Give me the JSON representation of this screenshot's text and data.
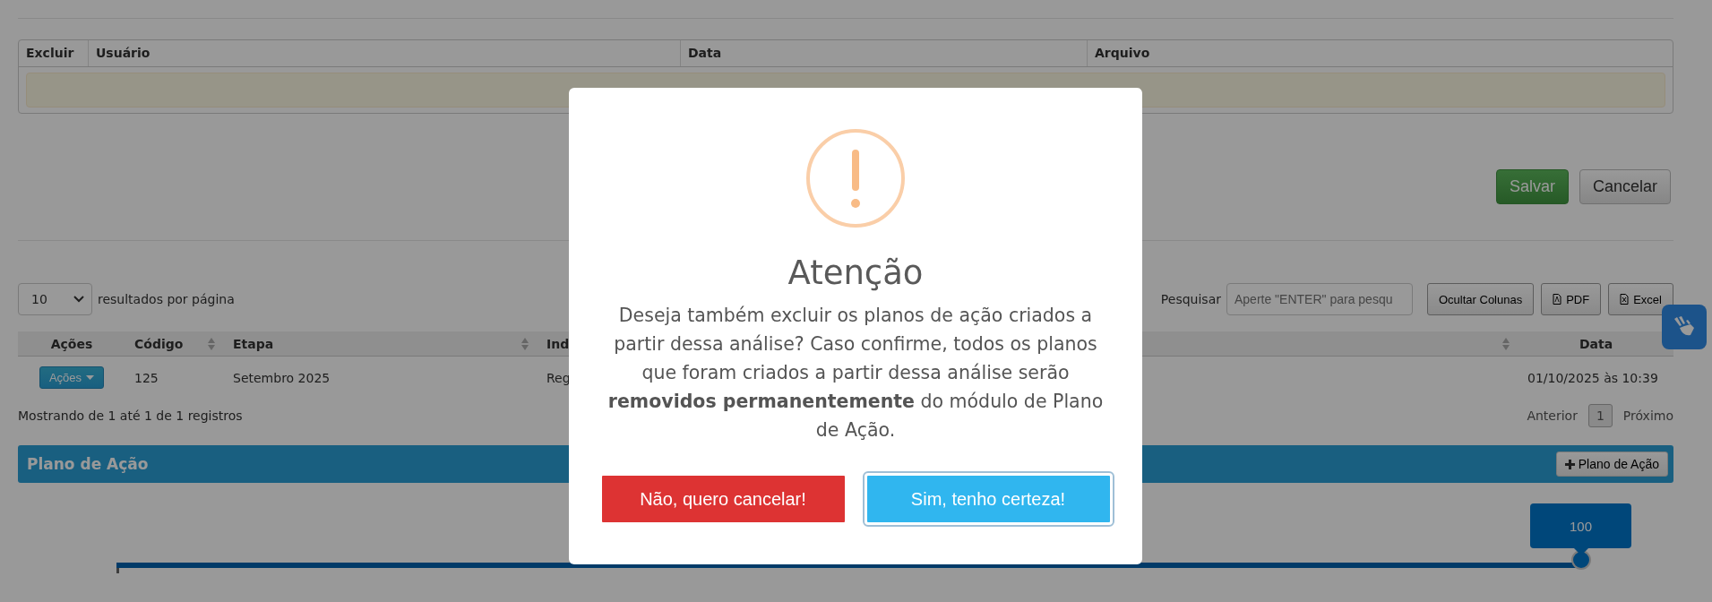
{
  "upload_table": {
    "columns": [
      "Excluir",
      "Usuário",
      "Data",
      "Arquivo"
    ]
  },
  "form_buttons": [
    {
      "label": "Salvar",
      "kind": "success"
    },
    {
      "label": "Cancelar",
      "kind": "default"
    }
  ],
  "length_select": {
    "value": "10",
    "label": "resultados por página"
  },
  "search": {
    "label": "Pesquisar",
    "placeholder": "Aperte \"ENTER\" para pesqu"
  },
  "export_buttons": [
    {
      "label": "Ocultar Colunas",
      "kind": "plain"
    },
    {
      "label": "PDF",
      "kind": "pdf"
    },
    {
      "label": "Excel",
      "kind": "excel"
    }
  ],
  "table": {
    "columns": [
      {
        "label": "Ações",
        "sortable": false
      },
      {
        "label": "Código",
        "sortable": true
      },
      {
        "label": "Etapa",
        "sortable": true
      },
      {
        "label": "Ind",
        "sortable": true
      },
      {
        "label": "Data",
        "sortable": false
      }
    ],
    "rows": [
      {
        "cells": [
          "Ações",
          "125",
          "Setembro 2025",
          "Reg",
          "01/10/2025 às 10:39"
        ]
      }
    ]
  },
  "info": "Mostrando de 1 até 1 de 1 registros",
  "pagination": {
    "previous": "Anterior",
    "pages": [
      {
        "label": "1",
        "selected": true
      }
    ],
    "next": "Próximo"
  },
  "section": {
    "title": "Plano de Ação",
    "button": "Plano de Ação"
  },
  "slider": {
    "value": "100",
    "level": 1
  },
  "modal": {
    "title": "Atenção",
    "message": "Deseja também excluir os planos de ação criados a partir dessa análise? Caso confirme, todos os planos que foram criados a partir dessa análise serão **removidos permanentemente** do módulo de Plano de Ação.",
    "buttons": [
      {
        "label": "Não, quero cancelar!",
        "kind": "cancel",
        "focused": false
      },
      {
        "label": "Sim, tenho certeza!",
        "kind": "confirm",
        "focused": true
      }
    ]
  }
}
